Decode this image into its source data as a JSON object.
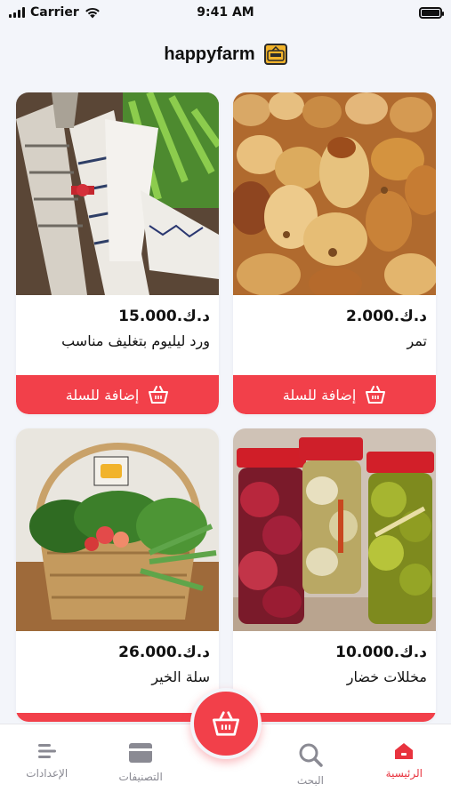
{
  "status_bar": {
    "carrier": "Carrier",
    "time": "9:41 AM"
  },
  "header": {
    "title": "happyfarm",
    "logo_text": "Happy Farm"
  },
  "products": [
    {
      "price": "د.ك.2.000",
      "name": "تمر",
      "add_label": "إضافة للسلة",
      "image": "dates"
    },
    {
      "price": "د.ك.15.000",
      "name": "ورد ليليوم بتغليف مناسب",
      "add_label": "إضافة للسلة",
      "image": "wrapped-flowers"
    },
    {
      "price": "د.ك.10.000",
      "name": "مخللات خضار",
      "add_label": "",
      "image": "pickle-jars"
    },
    {
      "price": "د.ك.26.000",
      "name": "سلة الخير",
      "add_label": "",
      "image": "vegetable-basket"
    }
  ],
  "tabs": [
    {
      "label": "الرئيسية",
      "icon": "home-icon",
      "active": true
    },
    {
      "label": "البحث",
      "icon": "search-icon",
      "active": false
    },
    {
      "label": "التصنيفات",
      "icon": "categories-icon",
      "active": false
    },
    {
      "label": "الإعدادات",
      "icon": "settings-icon",
      "active": false
    }
  ],
  "colors": {
    "accent": "#f2404a",
    "active_tab": "#e8333e",
    "inactive_tab": "#8a8a93",
    "background": "#f3f5fa"
  }
}
